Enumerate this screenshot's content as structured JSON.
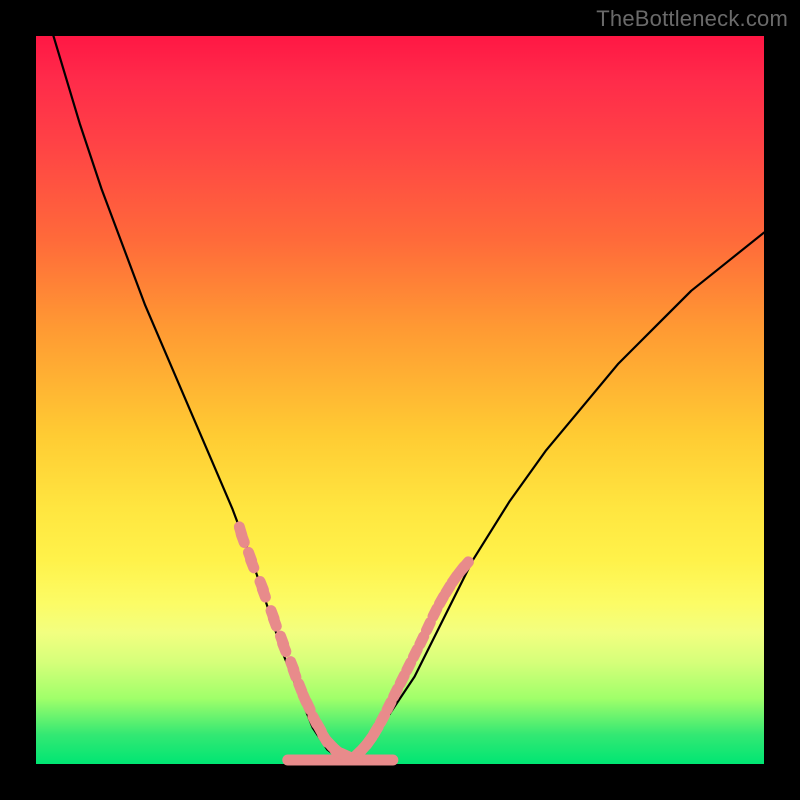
{
  "watermark": "TheBottleneck.com",
  "colors": {
    "frame": "#000000",
    "gradient_top": "#ff1744",
    "gradient_mid_top": "#ff9933",
    "gradient_mid": "#ffe640",
    "gradient_mid_bottom": "#d6ff7a",
    "gradient_bottom": "#00e673",
    "curve_stroke": "#000000",
    "lozenge_fill": "#e88b8b",
    "watermark_text": "#6a6a6a"
  },
  "chart_data": {
    "type": "line",
    "title": "",
    "xlabel": "",
    "ylabel": "",
    "xlim": [
      0,
      100
    ],
    "ylim": [
      0,
      100
    ],
    "grid": false,
    "legend": false,
    "series": [
      {
        "name": "bottleneck-curve",
        "x": [
          0,
          3,
          6,
          9,
          12,
          15,
          18,
          21,
          24,
          27,
          30,
          32,
          34,
          36,
          38,
          40,
          42,
          45,
          48,
          52,
          56,
          60,
          65,
          70,
          75,
          80,
          85,
          90,
          95,
          100
        ],
        "y": [
          108,
          98,
          88,
          79,
          71,
          63,
          56,
          49,
          42,
          35,
          27,
          21,
          15,
          10,
          5,
          2,
          0.5,
          2,
          6,
          12,
          20,
          28,
          36,
          43,
          49,
          55,
          60,
          65,
          69,
          73
        ]
      }
    ],
    "highlight_lozenges_left": {
      "name": "left-beads",
      "x": [
        28.1,
        28.4,
        29.4,
        29.7,
        31.0,
        31.3,
        32.5,
        32.8,
        33.8,
        34.1,
        35.2,
        35.5,
        36.3,
        36.9,
        37.4,
        38.3,
        38.9,
        39.7,
        40.3,
        41.1,
        41.6,
        42.5
      ],
      "y": [
        32,
        31,
        28.5,
        27.5,
        24.5,
        23.5,
        20.5,
        19.5,
        17,
        16,
        13.5,
        12.5,
        10.5,
        9,
        8,
        6,
        5,
        3.5,
        2.8,
        2.0,
        1.6,
        1.2
      ]
    },
    "highlight_lozenges_right": {
      "name": "right-beads",
      "x": [
        44.0,
        44.9,
        45.8,
        46.7,
        47.6,
        48.5,
        49.4,
        50.3,
        51.2,
        52.1,
        53.0,
        53.9,
        54.8,
        55.7,
        56.6,
        57.5,
        58.4,
        59.0
      ],
      "y": [
        1.2,
        2.1,
        3.2,
        4.6,
        6.2,
        8.0,
        9.8,
        11.6,
        13.4,
        15.2,
        17.0,
        18.9,
        20.8,
        22.5,
        24.0,
        25.4,
        26.6,
        27.3
      ]
    },
    "highlight_lozenges_bottom": {
      "name": "bottom-beads",
      "x": [
        35.2,
        36.3,
        37.4,
        38.5,
        39.6,
        40.7,
        41.8,
        42.9,
        44.0,
        45.1,
        46.2,
        47.3,
        48.4
      ],
      "y": [
        0.0,
        0.0,
        0.0,
        0.0,
        0.0,
        0.0,
        0.0,
        0.0,
        0.0,
        0.0,
        0.0,
        0.0,
        0.0
      ]
    }
  }
}
